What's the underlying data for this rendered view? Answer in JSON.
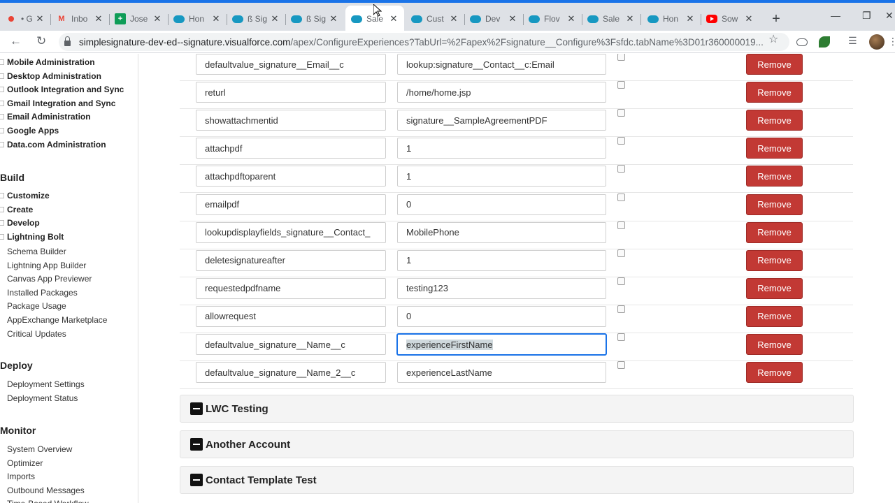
{
  "browser": {
    "tabs": [
      {
        "label": "• Ga",
        "icon": "google-icon"
      },
      {
        "label": "Inbo",
        "icon": "gmail-icon"
      },
      {
        "label": "Jose",
        "icon": "sheets-icon"
      },
      {
        "label": "Hon",
        "icon": "salesforce-icon"
      },
      {
        "label": "ß Sig",
        "icon": "salesforce-icon"
      },
      {
        "label": "ß Sig",
        "icon": "salesforce-icon"
      },
      {
        "label": "Sale",
        "icon": "salesforce-icon",
        "active": true
      },
      {
        "label": "Cust",
        "icon": "salesforce-icon"
      },
      {
        "label": "Dev",
        "icon": "salesforce-icon"
      },
      {
        "label": "Flov",
        "icon": "salesforce-icon"
      },
      {
        "label": "Sale",
        "icon": "salesforce-icon"
      },
      {
        "label": "Hon",
        "icon": "salesforce-icon"
      },
      {
        "label": "Sow",
        "icon": "youtube-icon"
      }
    ],
    "new_tab": "+",
    "url_host": "simplesignature-dev-ed--signature.visualforce.com",
    "url_path": "/apex/ConfigureExperiences?TabUrl=%2Fapex%2Fsignature__Configure%3Fsfdc.tabName%3D01r360000019..."
  },
  "sidebar": {
    "top_items": [
      "Mobile Administration",
      "Desktop Administration",
      "Outlook Integration and Sync",
      "Gmail Integration and Sync",
      "Email Administration",
      "Google Apps",
      "Data.com Administration"
    ],
    "build": {
      "heading": "Build",
      "items": [
        "Customize",
        "Create",
        "Develop",
        "Lightning Bolt"
      ],
      "subitems": [
        "Schema Builder",
        "Lightning App Builder",
        "Canvas App Previewer",
        "Installed Packages",
        "Package Usage",
        "AppExchange Marketplace",
        "Critical Updates"
      ]
    },
    "deploy": {
      "heading": "Deploy",
      "items": [
        "Deployment Settings",
        "Deployment Status"
      ]
    },
    "monitor": {
      "heading": "Monitor",
      "items": [
        "System Overview",
        "Optimizer",
        "Imports",
        "Outbound Messages",
        "Time-Based Workflow"
      ]
    }
  },
  "params": [
    {
      "key": "defaultvalue_signature__Email__c",
      "value": "lookup:signature__Contact__c:Email"
    },
    {
      "key": "returl",
      "value": "/home/home.jsp"
    },
    {
      "key": "showattachmentid",
      "value": "signature__SampleAgreementPDF"
    },
    {
      "key": "attachpdf",
      "value": "1"
    },
    {
      "key": "attachpdftoparent",
      "value": "1"
    },
    {
      "key": "emailpdf",
      "value": "0"
    },
    {
      "key": "lookupdisplayfields_signature__Contact_",
      "value": "MobilePhone"
    },
    {
      "key": "deletesignatureafter",
      "value": "1"
    },
    {
      "key": "requestedpdfname",
      "value": "testing123"
    },
    {
      "key": "allowrequest",
      "value": "0"
    },
    {
      "key": "defaultvalue_signature__Name__c",
      "value": "experienceFirstName",
      "focused": true
    },
    {
      "key": "defaultvalue_signature__Name_2__c",
      "value": "experienceLastName"
    }
  ],
  "remove_label": "Remove",
  "sections": [
    "LWC Testing",
    "Another Account",
    "Contact Template Test"
  ]
}
